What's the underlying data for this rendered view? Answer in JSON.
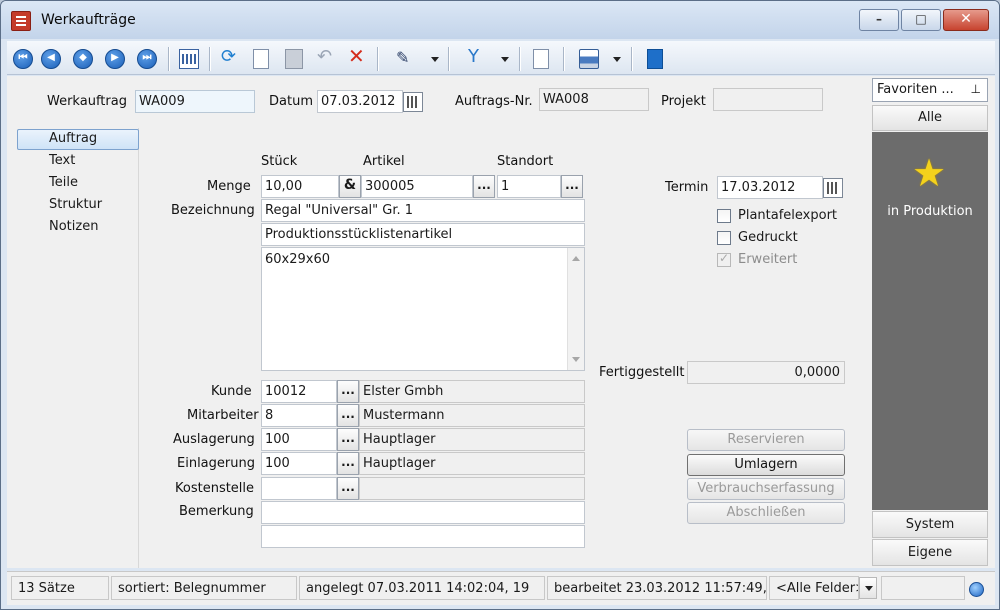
{
  "window": {
    "title": "Werkaufträge",
    "min_glyph": "–",
    "max_glyph": "□",
    "close_glyph": "✕"
  },
  "toolbar": {
    "icons": [
      "first-record-icon",
      "previous-record-icon",
      "view-icon",
      "next-record-icon",
      "last-record-icon",
      "table-view-icon",
      "refresh-icon",
      "new-document-icon",
      "save-icon",
      "undo-icon",
      "delete-icon",
      "tools-icon",
      "filter-icon",
      "document-icon",
      "print-icon",
      "book-icon"
    ],
    "nav_glyphs": {
      "first": "⏮",
      "prev": "◀",
      "view": "◆",
      "next": "▶",
      "last": "⏭"
    }
  },
  "header": {
    "werkauftrag_label": "Werkauftrag",
    "werkauftrag_value": "WA009",
    "datum_label": "Datum",
    "datum_value": "07.03.2012",
    "auftragsnr_label": "Auftrags-Nr.",
    "auftragsnr_value": "WA008",
    "projekt_label": "Projekt",
    "projekt_value": ""
  },
  "nav": {
    "items": [
      {
        "label": "Auftrag",
        "selected": true
      },
      {
        "label": "Text",
        "selected": false
      },
      {
        "label": "Teile",
        "selected": false
      },
      {
        "label": "Struktur",
        "selected": false
      },
      {
        "label": "Notizen",
        "selected": false
      }
    ]
  },
  "form": {
    "col_stueck": "Stück",
    "col_artikel": "Artikel",
    "col_standort": "Standort",
    "menge_label": "Menge",
    "menge_value": "10,00",
    "artikel_value": "300005",
    "standort_value": "1",
    "bezeichnung_label": "Bezeichnung",
    "bezeichnung_value": "Regal \"Universal\" Gr. 1",
    "bezeichnung2_value": "Produktionsstücklistenartikel",
    "text_value": "60x29x60",
    "dots": "...",
    "kunde_label": "Kunde",
    "kunde_value": "10012",
    "kunde_name": "Elster Gmbh",
    "mitarbeiter_label": "Mitarbeiter",
    "mitarbeiter_value": "8",
    "mitarbeiter_name": "Mustermann",
    "auslagerung_label": "Auslagerung",
    "auslagerung_value": "100",
    "auslagerung_name": "Hauptlager",
    "einlagerung_label": "Einlagerung",
    "einlagerung_value": "100",
    "einlagerung_name": "Hauptlager",
    "kostenstelle_label": "Kostenstelle",
    "kostenstelle_value": "",
    "bemerkung_label": "Bemerkung",
    "bemerkung_value": ""
  },
  "side": {
    "termin_label": "Termin",
    "termin_value": "17.03.2012",
    "checkboxes": [
      {
        "label": "Plantafelexport",
        "checked": false,
        "enabled": true
      },
      {
        "label": "Gedruckt",
        "checked": false,
        "enabled": true
      },
      {
        "label": "Erweitert",
        "checked": true,
        "enabled": false
      }
    ],
    "checkmark": "✓",
    "fertiggestellt_label": "Fertiggestellt",
    "fertiggestellt_value": "0,0000",
    "buttons": [
      {
        "label": "Reservieren",
        "enabled": false
      },
      {
        "label": "Umlagern",
        "enabled": true
      },
      {
        "label": "Verbrauchserfassung",
        "enabled": false
      },
      {
        "label": "Abschließen",
        "enabled": false
      }
    ]
  },
  "favorites": {
    "header": "Favoriten ...",
    "pin": "⊥",
    "tab_all": "Alle",
    "star_glyph": "★",
    "item_label": "in Produktion",
    "tab_system": "System",
    "tab_eigene": "Eigene"
  },
  "status": {
    "count": "13 Sätze",
    "sort": "sortiert: Belegnummer",
    "created": "angelegt 07.03.2011 14:02:04, 19",
    "edited": "bearbeitet 23.03.2012 11:57:49,",
    "fields": "<Alle Felder>"
  },
  "colors": {
    "accent": "#1b5fb8",
    "panel_dark": "#6c6c6c",
    "star": "#f4d21c"
  }
}
